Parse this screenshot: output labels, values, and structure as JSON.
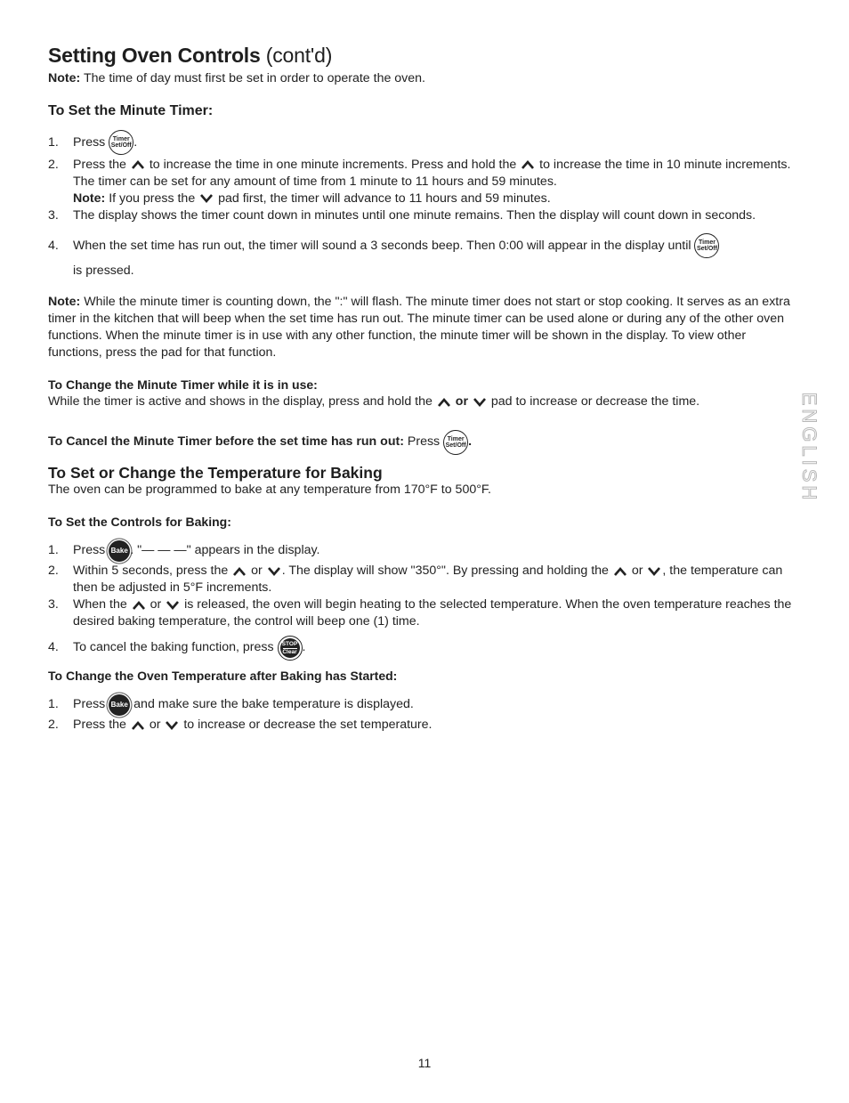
{
  "header": {
    "title_bold": "Setting Oven Controls",
    "title_light": " (cont'd)",
    "note_label": "Note:",
    "note_text": " The time of day must first be set in order to operate the oven."
  },
  "icons": {
    "timer_line1": "Timer",
    "timer_line2": "Set/Off",
    "bake": "Bake",
    "stop_line1": "STOP",
    "stop_line2": "Clear"
  },
  "minute_timer": {
    "heading": "To Set the Minute Timer:",
    "steps": [
      {
        "num": "1.",
        "a": "Press ",
        "b": "."
      },
      {
        "num": "2.",
        "a": "Press the ",
        "b": " to increase the time in one minute increments. Press and hold the ",
        "c": " to increase the time in 10 minute increments. The timer can be set for any amount of time from 1 minute to 11 hours and 59 minutes.",
        "note_label": "Note:",
        "note_a": " If you press the ",
        "note_b": " pad first, the timer will advance to 11 hours and 59 minutes."
      },
      {
        "num": "3.",
        "a": "The display shows the timer count down in minutes until one minute remains. Then the display will count down in seconds."
      },
      {
        "num": "4.",
        "a": "When the set time has run out, the timer will sound a 3 seconds beep. Then 0:00 will appear in the display until ",
        "b": "is pressed."
      }
    ],
    "note_label": "Note:",
    "note_text": " While the minute timer is counting down, the \":\" will flash. The minute timer does not start or stop cooking. It serves as an extra timer in the kitchen that will beep when the set time has run out. The minute timer can be used alone or during any of the other oven functions. When the minute timer is in use with any other function, the minute timer will be shown in the display. To view other functions, press the pad for that function.",
    "change_heading": "To Change the Minute Timer while it is in use:",
    "change_a": "While the timer is active and shows in the display, press and hold the ",
    "change_or": " or ",
    "change_b": " pad to increase or decrease the time.",
    "cancel_heading": "To Cancel the Minute Timer before the set time has run out:",
    "cancel_press": " Press ",
    "cancel_end": "."
  },
  "baking": {
    "heading": "To Set or Change the Temperature for Baking",
    "intro": "The oven can be programmed to bake at any temperature from 170°F to 500°F.",
    "set_heading": "To Set the Controls for Baking:",
    "steps": [
      {
        "num": "1.",
        "a": "Press ",
        "b": ". \"— — —\" appears in the display."
      },
      {
        "num": "2.",
        "a": "Within 5 seconds, press the ",
        "or": " or ",
        "b": ". The display will show \"350°\". By pressing and holding the ",
        "c": ", the temperature can then be adjusted in 5°F increments."
      },
      {
        "num": "3.",
        "a": "When the ",
        "or": " or ",
        "b": " is released, the oven will begin heating to the selected temperature. When the oven temperature reaches the desired baking temperature, the control will beep one (1) time."
      },
      {
        "num": "4.",
        "a": "To cancel the baking function, press ",
        "b": "."
      }
    ],
    "change_heading": "To Change the Oven Temperature after Baking has Started:",
    "change_steps": [
      {
        "num": "1.",
        "a": "Press ",
        "b": " and make sure the bake temperature is displayed."
      },
      {
        "num": "2.",
        "a": "Press the ",
        "or": " or ",
        "b": " to increase or decrease the set temperature."
      }
    ]
  },
  "side_tab": "ENGLISH",
  "page_number": "11"
}
